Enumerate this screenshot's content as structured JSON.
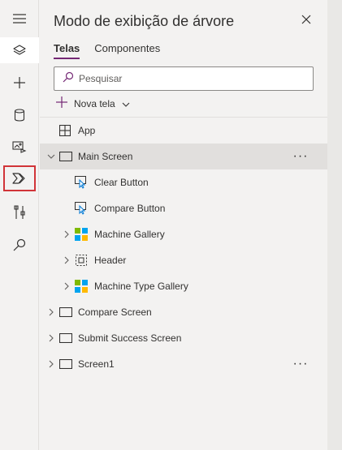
{
  "panel": {
    "title": "Modo de exibição de árvore",
    "tabs": [
      {
        "label": "Telas",
        "active": true
      },
      {
        "label": "Componentes",
        "active": false
      }
    ],
    "search": {
      "placeholder": "Pesquisar",
      "value": ""
    },
    "new_screen_label": "Nova tela"
  },
  "rail": {
    "items": [
      {
        "icon": "hamburger-menu-icon"
      },
      {
        "icon": "layers-icon",
        "active": true
      },
      {
        "icon": "plus-icon"
      },
      {
        "icon": "database-icon"
      },
      {
        "icon": "media-icon"
      },
      {
        "icon": "power-automate-icon",
        "highlighted": true
      },
      {
        "icon": "tools-icon"
      },
      {
        "icon": "search-icon"
      }
    ]
  },
  "tree": {
    "rows": [
      {
        "label": "App",
        "icon": "app-icon",
        "level": 0,
        "expandable": false
      },
      {
        "label": "Main Screen",
        "icon": "screen-icon",
        "level": 0,
        "expandable": true,
        "expanded": true,
        "selected": true,
        "more": "···"
      },
      {
        "label": "Clear Button",
        "icon": "button-icon",
        "level": 1,
        "expandable": false
      },
      {
        "label": "Compare Button",
        "icon": "button-icon",
        "level": 1,
        "expandable": false
      },
      {
        "label": "Machine Gallery",
        "icon": "gallery-icon",
        "level": 1,
        "expandable": true
      },
      {
        "label": "Header",
        "icon": "group-icon",
        "level": 1,
        "expandable": true
      },
      {
        "label": "Machine Type Gallery",
        "icon": "gallery-icon",
        "level": 1,
        "expandable": true
      },
      {
        "label": "Compare Screen",
        "icon": "screen-icon",
        "level": 0,
        "expandable": true
      },
      {
        "label": "Submit Success Screen",
        "icon": "screen-icon",
        "level": 0,
        "expandable": true
      },
      {
        "label": "Screen1",
        "icon": "screen-icon",
        "level": 0,
        "expandable": true,
        "more": "···"
      }
    ]
  },
  "colors": {
    "accent": "#742774",
    "highlight_border": "#d13438",
    "selected_row": "#e1dfdd",
    "gallery_green": "#7fba00",
    "gallery_blue": "#00a4ef",
    "gallery_orange": "#f25022",
    "gallery_yellow": "#ffb900"
  }
}
